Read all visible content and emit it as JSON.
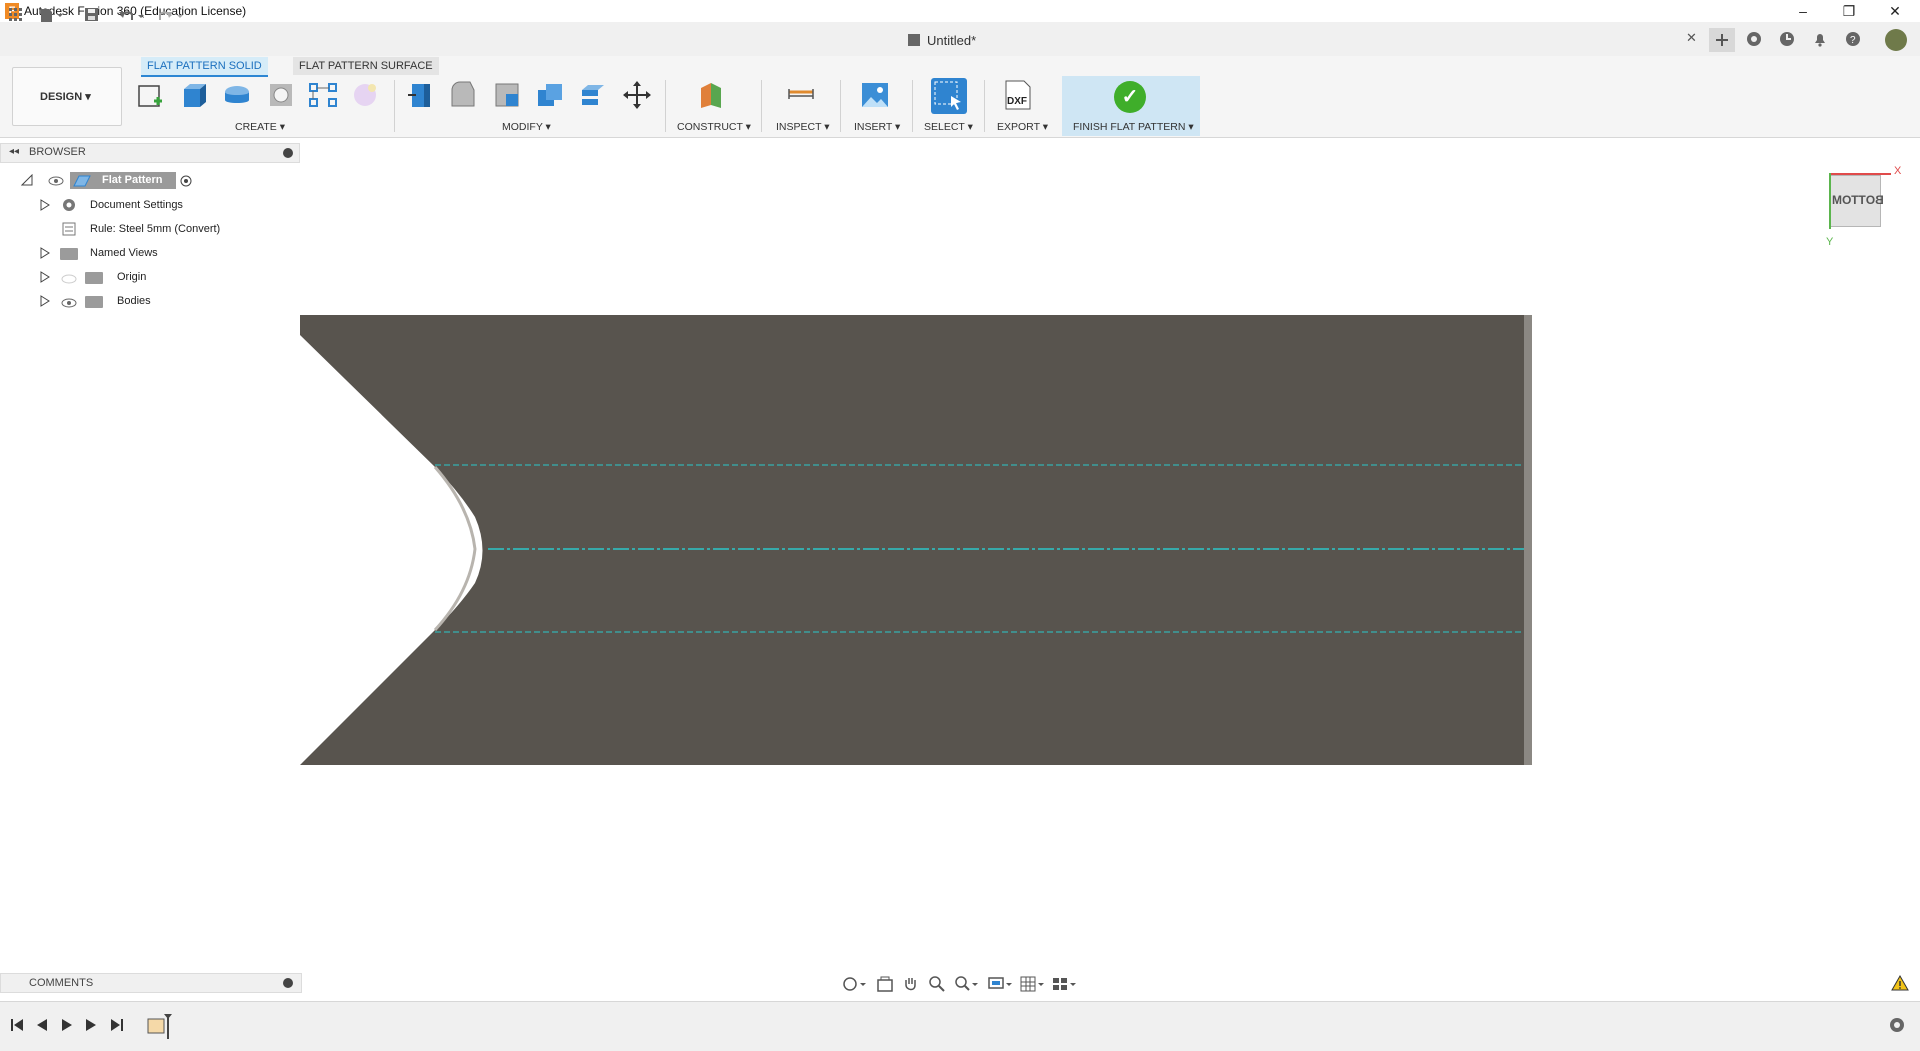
{
  "window": {
    "title": "Autodesk Fusion 360 (Education License)",
    "logo": "F",
    "minimize": "–",
    "restore": "❐",
    "close": "✕"
  },
  "document": {
    "title": "Untitled*",
    "close": "✕"
  },
  "ribbon": {
    "tabs": [
      "FLAT PATTERN SOLID",
      "FLAT PATTERN SURFACE"
    ],
    "workspace": "DESIGN ▾",
    "groups": {
      "create": "CREATE ▾",
      "modify": "MODIFY ▾",
      "construct": "CONSTRUCT ▾",
      "inspect": "INSPECT ▾",
      "insert": "INSERT ▾",
      "select": "SELECT ▾",
      "export": "EXPORT ▾",
      "finish": "FINISH FLAT PATTERN ▾"
    },
    "export_icon_text": "DXF",
    "finish_icon": "✓"
  },
  "browser": {
    "title": "BROWSER",
    "items": [
      {
        "label": "Flat Pattern"
      },
      {
        "label": "Document Settings"
      },
      {
        "label": "Rule: Steel 5mm (Convert)"
      },
      {
        "label": "Named Views"
      },
      {
        "label": "Origin"
      },
      {
        "label": "Bodies"
      }
    ]
  },
  "viewcube": {
    "face": "BOTTOM",
    "axis_x": "X",
    "axis_y": "Y"
  },
  "comments": {
    "title": "COMMENTS"
  },
  "colors": {
    "accent": "#2d86d3",
    "part_fill": "#58544e",
    "bend_line": "#2ac7c9",
    "finish_green": "#3fae2a"
  }
}
